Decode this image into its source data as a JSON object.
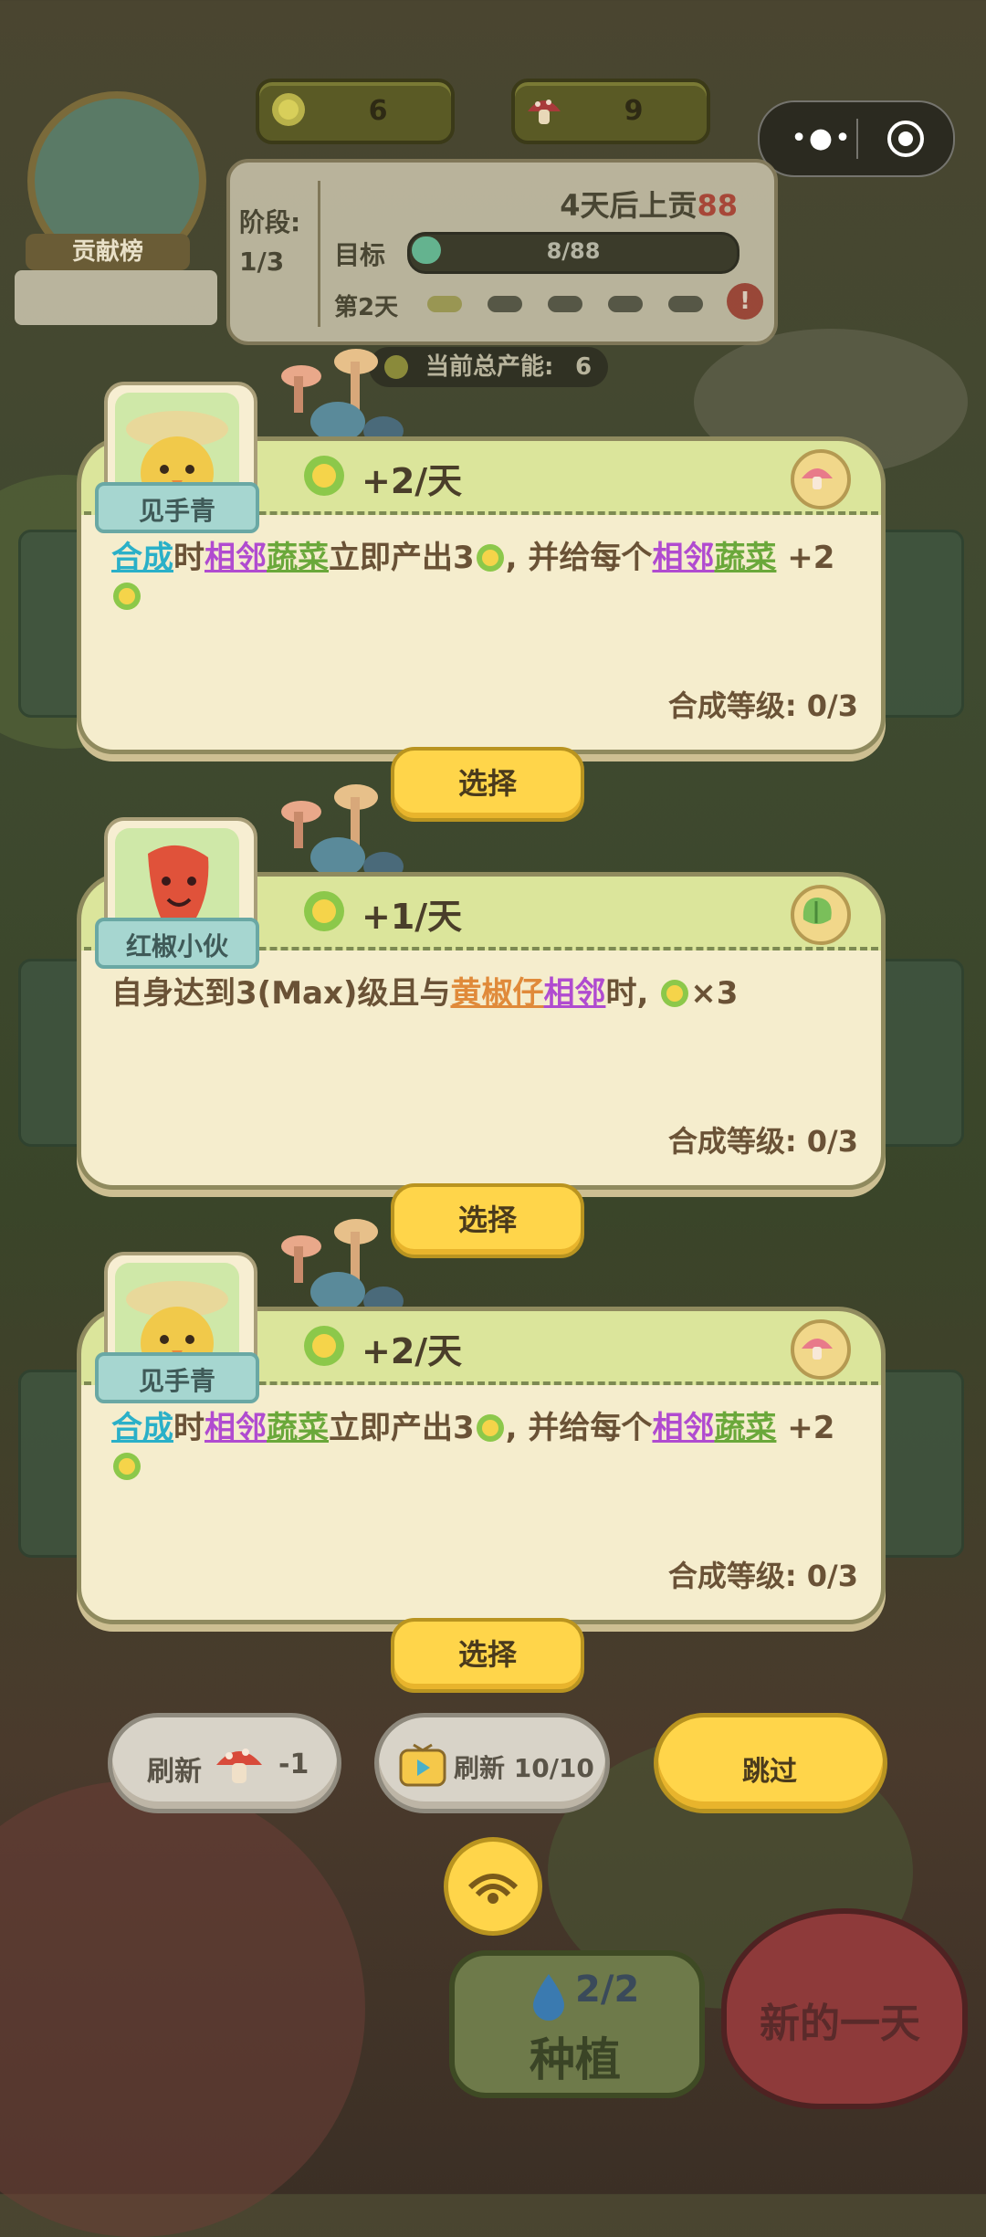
{
  "hud": {
    "sun_count": "6",
    "mushroom_count": "9",
    "rank_label": "贡献榜",
    "stage_label": "阶段:",
    "stage_value": "1/3",
    "tribute_prefix": "4天后上贡",
    "tribute_amount": "88",
    "target_label": "目标",
    "target_progress": "8/88",
    "target_fraction": 0.09,
    "day_label": "第2天",
    "capacity_label": "当前总产能:",
    "capacity_value": "6"
  },
  "cards": [
    {
      "name": "见手青",
      "rate": "+2/天",
      "desc": [
        {
          "t": "合成",
          "c": "blue"
        },
        {
          "t": "时",
          "c": ""
        },
        {
          "t": "相邻",
          "c": "purple"
        },
        {
          "t": "蔬菜",
          "c": "green"
        },
        {
          "t": "立即产出3",
          "c": ""
        },
        {
          "t": "SUN",
          "c": "icon"
        },
        {
          "t": ", 并给每个",
          "c": ""
        },
        {
          "t": "相邻",
          "c": "purple"
        },
        {
          "t": "蔬菜",
          "c": "green"
        },
        {
          "t": " +2",
          "c": ""
        },
        {
          "t": "SUN",
          "c": "icon"
        }
      ],
      "level": "合成等级: 0/3",
      "select": "选择"
    },
    {
      "name": "红椒小伙",
      "rate": "+1/天",
      "desc": [
        {
          "t": "自身达到3(Max)级且与",
          "c": ""
        },
        {
          "t": "黄椒仔",
          "c": "orange"
        },
        {
          "t": "相邻",
          "c": "purple"
        },
        {
          "t": "时, ",
          "c": ""
        },
        {
          "t": "SUN",
          "c": "icon"
        },
        {
          "t": "×3",
          "c": ""
        }
      ],
      "level": "合成等级: 0/3",
      "select": "选择"
    },
    {
      "name": "见手青",
      "rate": "+2/天",
      "desc": [
        {
          "t": "合成",
          "c": "blue"
        },
        {
          "t": "时",
          "c": ""
        },
        {
          "t": "相邻",
          "c": "purple"
        },
        {
          "t": "蔬菜",
          "c": "green"
        },
        {
          "t": "立即产出3",
          "c": ""
        },
        {
          "t": "SUN",
          "c": "icon"
        },
        {
          "t": ", 并给每个",
          "c": ""
        },
        {
          "t": "相邻",
          "c": "purple"
        },
        {
          "t": "蔬菜",
          "c": "green"
        },
        {
          "t": " +2",
          "c": ""
        },
        {
          "t": "SUN",
          "c": "icon"
        }
      ],
      "level": "合成等级: 0/3",
      "select": "选择"
    }
  ],
  "bottom": {
    "refresh_mushroom_label": "刷新",
    "refresh_mushroom_cost": "-1",
    "refresh_ad_label": "刷新 10/10",
    "skip_label": "跳过",
    "water_count": "2/2",
    "plant_label": "种植",
    "new_day_label": "新的一天"
  },
  "colors": {
    "card_head": "#dbe59b",
    "card_body": "#f5edcd",
    "button_yellow": "#ffd54a",
    "keyword_blue": "#2ab0c8",
    "keyword_purple": "#b04bd0",
    "keyword_green": "#6aa83a",
    "keyword_orange": "#e08a3a"
  }
}
